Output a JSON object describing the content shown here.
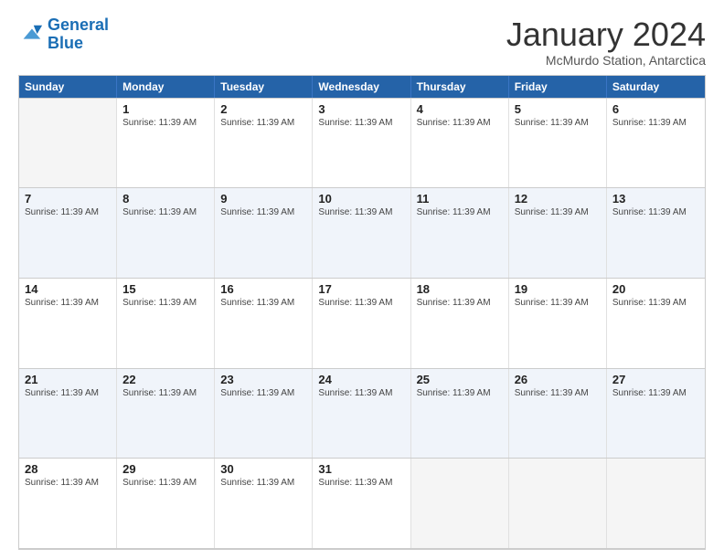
{
  "logo": {
    "line1": "General",
    "line2": "Blue"
  },
  "header": {
    "month_year": "January 2024",
    "location": "McMurdo Station, Antarctica"
  },
  "days_of_week": [
    "Sunday",
    "Monday",
    "Tuesday",
    "Wednesday",
    "Thursday",
    "Friday",
    "Saturday"
  ],
  "sunrise_label": "Sunrise: 11:39 AM",
  "weeks": [
    [
      {
        "day": "",
        "empty": true
      },
      {
        "day": "1",
        "info": "Sunrise: 11:39 AM"
      },
      {
        "day": "2",
        "info": "Sunrise: 11:39 AM"
      },
      {
        "day": "3",
        "info": "Sunrise: 11:39 AM"
      },
      {
        "day": "4",
        "info": "Sunrise: 11:39 AM"
      },
      {
        "day": "5",
        "info": "Sunrise: 11:39 AM"
      },
      {
        "day": "6",
        "info": "Sunrise: 11:39 AM"
      }
    ],
    [
      {
        "day": "7",
        "info": "Sunrise: 11:39 AM"
      },
      {
        "day": "8",
        "info": "Sunrise: 11:39 AM"
      },
      {
        "day": "9",
        "info": "Sunrise: 11:39 AM"
      },
      {
        "day": "10",
        "info": "Sunrise: 11:39 AM"
      },
      {
        "day": "11",
        "info": "Sunrise: 11:39 AM"
      },
      {
        "day": "12",
        "info": "Sunrise: 11:39 AM"
      },
      {
        "day": "13",
        "info": "Sunrise: 11:39 AM"
      }
    ],
    [
      {
        "day": "14",
        "info": "Sunrise: 11:39 AM"
      },
      {
        "day": "15",
        "info": "Sunrise: 11:39 AM"
      },
      {
        "day": "16",
        "info": "Sunrise: 11:39 AM"
      },
      {
        "day": "17",
        "info": "Sunrise: 11:39 AM"
      },
      {
        "day": "18",
        "info": "Sunrise: 11:39 AM"
      },
      {
        "day": "19",
        "info": "Sunrise: 11:39 AM"
      },
      {
        "day": "20",
        "info": "Sunrise: 11:39 AM"
      }
    ],
    [
      {
        "day": "21",
        "info": "Sunrise: 11:39 AM"
      },
      {
        "day": "22",
        "info": "Sunrise: 11:39 AM"
      },
      {
        "day": "23",
        "info": "Sunrise: 11:39 AM"
      },
      {
        "day": "24",
        "info": "Sunrise: 11:39 AM"
      },
      {
        "day": "25",
        "info": "Sunrise: 11:39 AM"
      },
      {
        "day": "26",
        "info": "Sunrise: 11:39 AM"
      },
      {
        "day": "27",
        "info": "Sunrise: 11:39 AM"
      }
    ],
    [
      {
        "day": "28",
        "info": "Sunrise: 11:39 AM"
      },
      {
        "day": "29",
        "info": "Sunrise: 11:39 AM"
      },
      {
        "day": "30",
        "info": "Sunrise: 11:39 AM"
      },
      {
        "day": "31",
        "info": "Sunrise: 11:39 AM"
      },
      {
        "day": "",
        "empty": true
      },
      {
        "day": "",
        "empty": true
      },
      {
        "day": "",
        "empty": true
      }
    ]
  ]
}
